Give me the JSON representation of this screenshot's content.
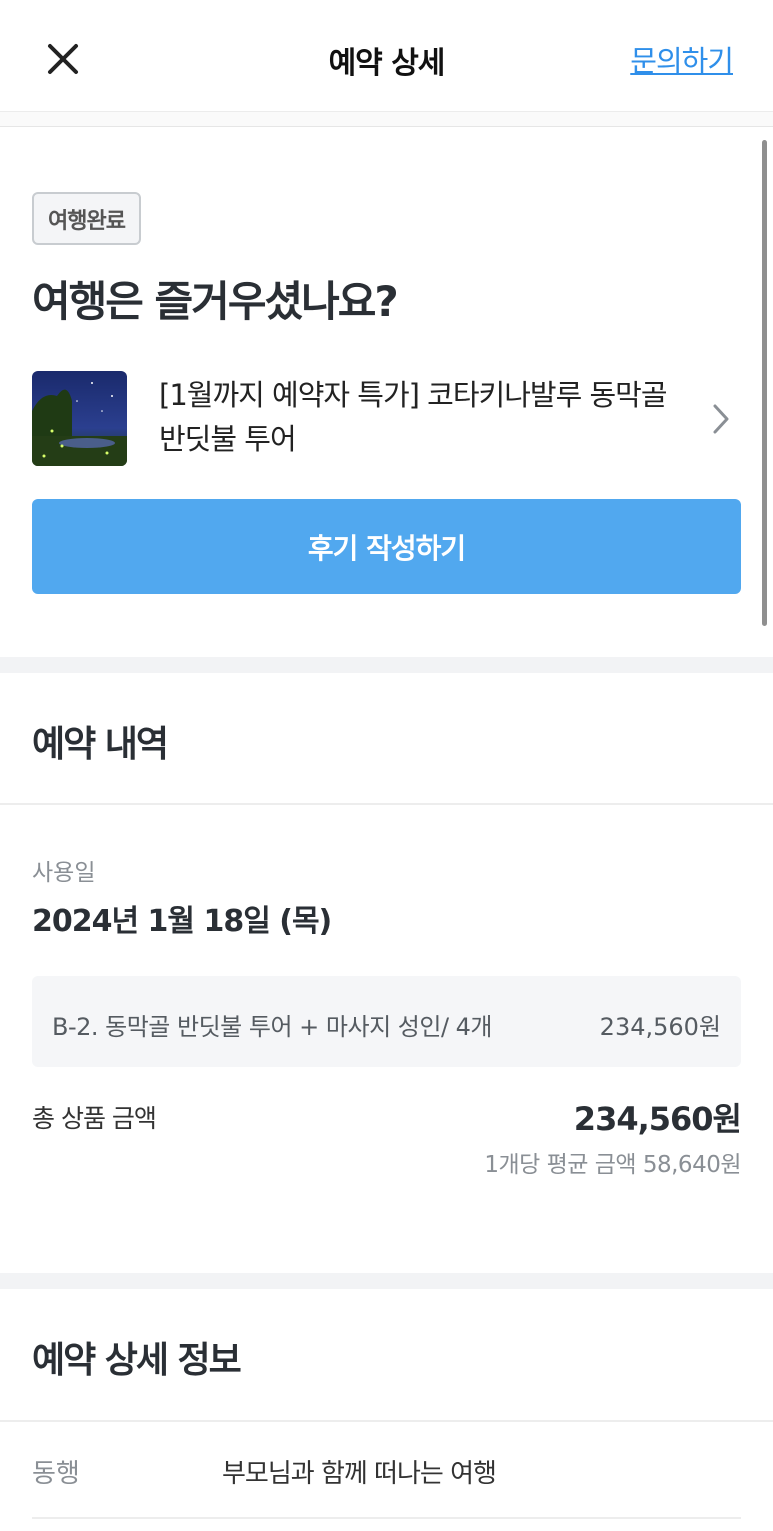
{
  "header": {
    "title": "예약 상세",
    "inquiry_label": "문의하기",
    "close_icon": "close-icon"
  },
  "status": {
    "badge": "여행완료",
    "headline": "여행은 즐거우셨나요?"
  },
  "product": {
    "name": "[1월까지 예약자 특가] 코타키나발루 동막골 반딧불 투어"
  },
  "review_button_label": "후기 작성하기",
  "reservation": {
    "section_title": "예약 내역",
    "use_date_label": "사용일",
    "use_date": "2024년 1월 18일 (목)",
    "option_name": "B-2. 동막골 반딧불 투어 + 마사지 성인/ 4개",
    "option_price": "234,560원",
    "total_label": "총 상품 금액",
    "total_value": "234,560원",
    "average_text": "1개당 평균 금액 58,640원"
  },
  "details": {
    "section_title": "예약 상세 정보",
    "rows": [
      {
        "key": "동행",
        "value": "부모님과 함께 떠나는 여행"
      }
    ]
  },
  "colors": {
    "accent": "#51a8ef",
    "link": "#2f8fea",
    "divider": "#f2f3f5"
  }
}
